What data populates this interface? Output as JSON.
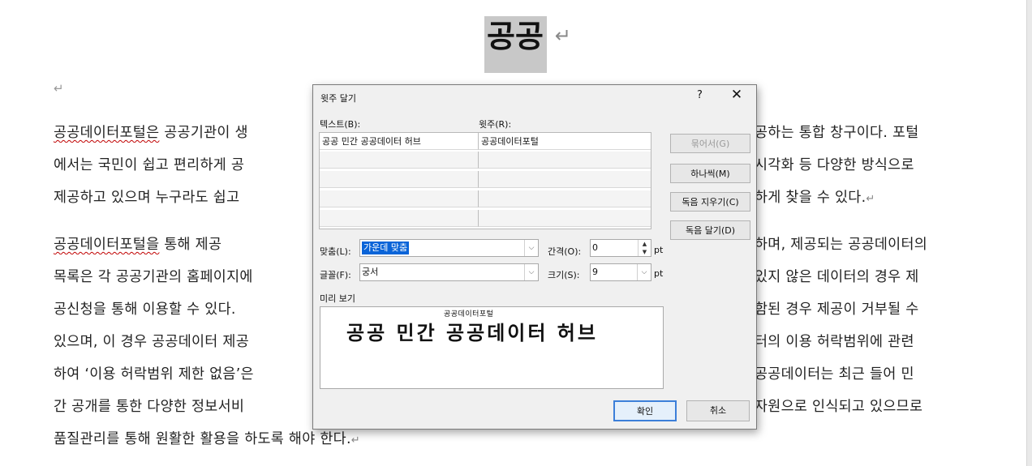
{
  "document": {
    "title": "공공",
    "para_mark": "↵",
    "lines": [
      {
        "segments": [
          {
            "text": "공공데이터포털은",
            "wavy": true
          },
          {
            "text": " 공공기관이 생"
          },
          {
            "text": "공하는 통합 창구이다. 포털"
          }
        ]
      },
      {
        "segments": [
          {
            "text": "에서는 국민이 쉽고 편리하게 공"
          },
          {
            "text": "시각화 등 다양한 방식으로"
          }
        ]
      },
      {
        "segments": [
          {
            "text": "제공하고 있으며 누구라도 쉽고"
          },
          {
            "text": "하게 찾을 수 있다."
          }
        ],
        "end_mark": true
      },
      {
        "segments": [
          {
            "text": "  "
          },
          {
            "text": "공공데이터포털을",
            "wavy": true
          },
          {
            "text": " 통해 제공 "
          },
          {
            "text": "하며, 제공되는 공공데이터의"
          }
        ]
      },
      {
        "segments": [
          {
            "text": "목록은 각 공공기관의 홈페이지에"
          },
          {
            "text": "있지 않은 데이터의 경우 제"
          }
        ]
      },
      {
        "segments": [
          {
            "text": "공신청을 통해 이용할 수 있다."
          },
          {
            "text": "함된 경우 제공이 거부될 수"
          }
        ]
      },
      {
        "segments": [
          {
            "text": "있으며, 이 경우 공공데이터 제공"
          },
          {
            "text": "터의 이용 허락범위에 관련"
          }
        ]
      },
      {
        "segments": [
          {
            "text": "하여 ‘이용 허락범위 제한 없음’은"
          },
          {
            "text": "공공데이터는 최근 들어 민"
          }
        ]
      },
      {
        "segments": [
          {
            "text": "간 공개를 통한 다양한 정보서비"
          },
          {
            "text": "자원으로 인식되고 있으므로"
          }
        ]
      },
      {
        "segments": [
          {
            "text": "품질관리를 통해 원활한 활용을 하도록 해야 한다."
          }
        ],
        "end_mark": true
      }
    ]
  },
  "dialog": {
    "title": "윗주 달기",
    "help": "?",
    "close": "✕",
    "text_header": "텍스트(B):",
    "ruby_header": "윗주(R):",
    "rows": [
      {
        "text": "공공 민간 공공데이터 허브",
        "ruby": "공공데이터포털"
      },
      {
        "text": "",
        "ruby": ""
      },
      {
        "text": "",
        "ruby": ""
      },
      {
        "text": "",
        "ruby": ""
      },
      {
        "text": "",
        "ruby": ""
      }
    ],
    "buttons": {
      "group": "묶어서(G)",
      "mono": "하나씩(M)",
      "clear": "독음 지우기(C)",
      "default": "독음 달기(D)",
      "ok": "확인",
      "cancel": "취소"
    },
    "alignment_label": "맞춤(L):",
    "alignment_value": "가운데 맞춤",
    "offset_label": "간격(O):",
    "offset_value": "0",
    "offset_unit": "pt",
    "font_label": "글꼴(F):",
    "font_value": "궁서",
    "size_label": "크기(S):",
    "size_value": "9",
    "size_unit": "pt",
    "preview_label": "미리 보기",
    "preview_ruby": "공공데이터포털",
    "preview_base": "공공 민간 공공데이터 허브"
  }
}
